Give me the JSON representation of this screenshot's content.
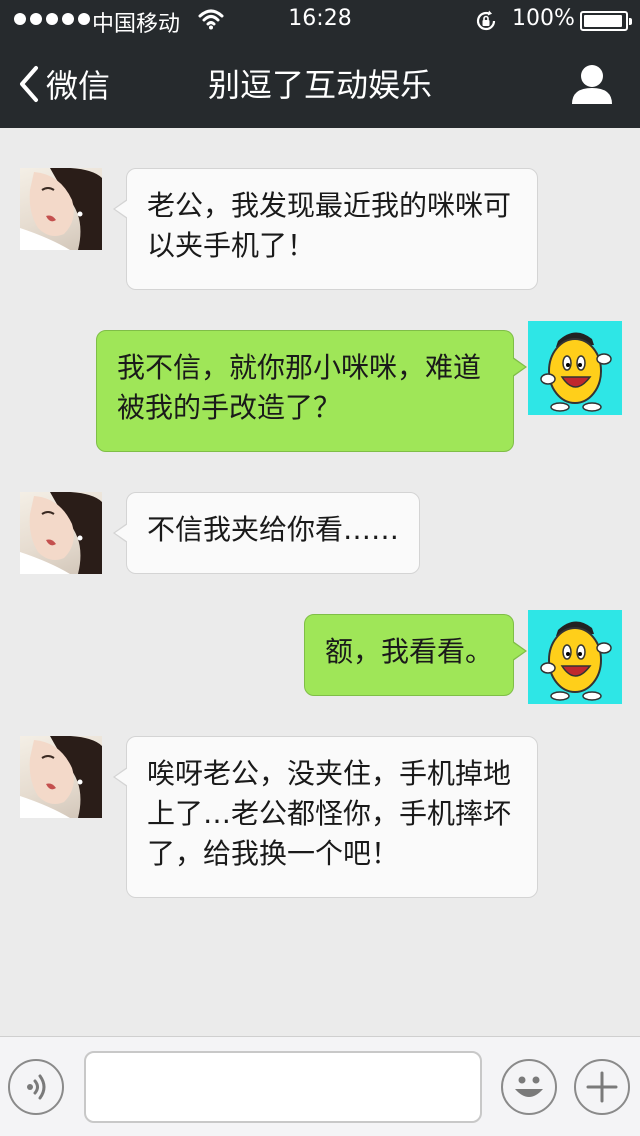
{
  "status_bar": {
    "carrier": "中国移动",
    "time": "16:28",
    "battery_percent": "100%",
    "battery_level": 1.0,
    "signal_icon": "signal-dots-icon",
    "wifi_icon": "wifi-icon",
    "lock_icon": "rotation-lock-icon"
  },
  "nav": {
    "back_label": "微信",
    "title": "别逗了互动娱乐",
    "profile_icon": "person-icon"
  },
  "messages": [
    {
      "side": "incoming",
      "avatar": "girl-photo",
      "lines": [
        "老公，我发现最近我的咪咪可",
        "以夹手机了！"
      ]
    },
    {
      "side": "outgoing",
      "avatar": "yellow-bean-cartoon",
      "lines": [
        "我不信，就你那小咪咪，难道",
        "被我的手改造了？"
      ]
    },
    {
      "side": "incoming",
      "avatar": "girl-photo",
      "lines": [
        "不信我夹给你看……"
      ]
    },
    {
      "side": "outgoing",
      "avatar": "yellow-bean-cartoon",
      "lines": [
        "额，我看看。"
      ]
    },
    {
      "side": "incoming",
      "avatar": "girl-photo",
      "lines": [
        "唉呀老公，没夹住，手机掉地",
        "上了…老公都怪你，手机摔坏",
        "了，给我换一个吧！"
      ]
    }
  ],
  "input_bar": {
    "voice_icon": "voice-icon",
    "text_value": "",
    "emoji_icon": "smiley-icon",
    "more_icon": "plus-icon"
  },
  "colors": {
    "nav_bg": "#262a2d",
    "chat_bg": "#ebebeb",
    "incoming_bubble": "#fafafa",
    "outgoing_bubble": "#9fe658",
    "avatar_emoji_bg": "#2ee6e6"
  }
}
